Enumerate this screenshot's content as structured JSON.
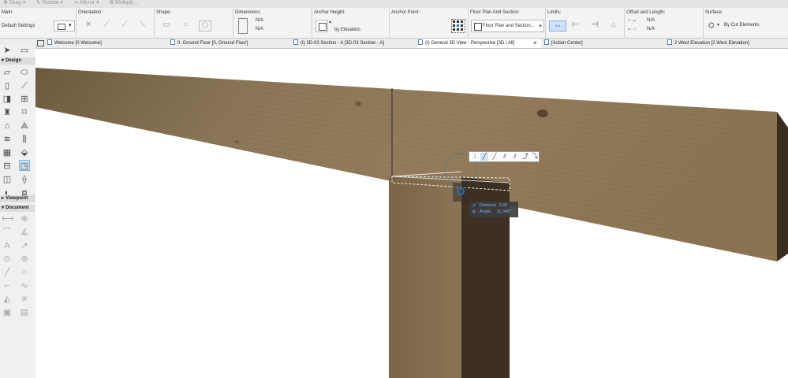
{
  "toolbar": {
    "drag": "Drag",
    "rotate": "Rotate",
    "mirror": "Mirror",
    "multiply": "Multiply..."
  },
  "info_box": {
    "main_label": "Main:",
    "main_value": "Default Settings",
    "orientation_label": "Orientation:",
    "shape_label": "Shape:",
    "dimensions_label": "Dimensions:",
    "dim_width": "N/A",
    "dim_height": "N/A",
    "anchor_height_label": "Anchor Height:",
    "anchor_height_value": "by Elevation",
    "anchor_point_label": "Anchor Point:",
    "floorplan_label": "Floor Plan And Section:",
    "floorplan_value": "Floor Plan and Section...",
    "limits_label": "Limits:",
    "offset_label": "Offset and Length:",
    "offset_value": "N/A",
    "length_value": "N/A",
    "surface_label": "Surface:",
    "surface_value": "By Cut Elements"
  },
  "tabs": [
    {
      "label": "Welcome [0 Welcome]"
    },
    {
      "label": "0. Ground Floor [0. Ground Floor]"
    },
    {
      "label": "(I) 3D-03 Section - A [3D-03 Section - A]"
    },
    {
      "label": "(I) General 3D View - Perspective [3D / All]"
    },
    {
      "label": "[Action Center]"
    },
    {
      "label": "2 West Elevation [2 West Elevation]"
    }
  ],
  "close_glyph": "×",
  "toolbox": {
    "design": "Design",
    "viewpoint": "Viewpoint",
    "document": "Document"
  },
  "tracker": {
    "distance_label": "Distance",
    "distance_value": "2.92",
    "angle_label": "Angle",
    "angle_value": "11.348°"
  }
}
